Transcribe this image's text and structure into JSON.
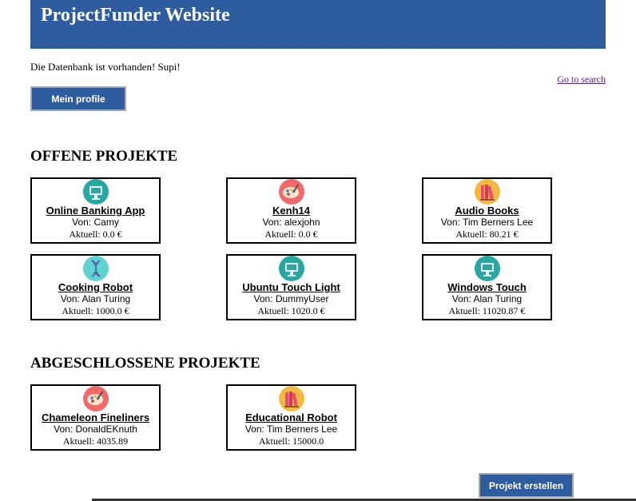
{
  "header": {
    "title": "ProjectFunder Website"
  },
  "db_status": "Die Datenbank ist vorhanden! Supi!",
  "search_link": "Go to search",
  "profile_button": "Mein profile",
  "create_button": "Projekt erstellen",
  "sections": {
    "open_title": "OFFENE PROJEKTE",
    "closed_title": "ABGESCHLOSSENE PROJEKTE"
  },
  "open_projects": [
    {
      "title": "Online Banking App",
      "author": "Von: Camy",
      "amount": "Aktuell: 0.0 €",
      "icon": "computer-icon"
    },
    {
      "title": "Kenh14",
      "author": "Von: alexjohn",
      "amount": "Aktuell: 0.0 €",
      "icon": "palette-icon"
    },
    {
      "title": "Audio Books",
      "author": "Von: Tim Berners Lee",
      "amount": "Aktuell: 80.21 €",
      "icon": "books-icon"
    },
    {
      "title": "Cooking Robot",
      "author": "Von: Alan Turing",
      "amount": "Aktuell: 1000.0 €",
      "icon": "dna-icon"
    },
    {
      "title": "Ubuntu Touch Light",
      "author": "Von: DummyUser",
      "amount": "Aktuell: 1020.0 €",
      "icon": "computer-icon"
    },
    {
      "title": "Windows Touch",
      "author": "Von: Alan Turing",
      "amount": "Aktuell: 11020.87 €",
      "icon": "computer-icon"
    }
  ],
  "closed_projects": [
    {
      "title": "Chameleon Fineliners ",
      "author": "Von: DonaldEKnuth",
      "amount": "Aktuell: 4035.89",
      "icon": "palette-icon"
    },
    {
      "title": "Educational Robot",
      "author": "Von: Tim Berners Lee",
      "amount": "Aktuell: 15000.0",
      "icon": "books-icon"
    }
  ],
  "colors": {
    "brand_blue": "#2e5c9e",
    "computer_icon_bg": "#2aa7a0",
    "palette_icon_bg": "#f06a6a",
    "books_icon_bg": "#f5b840",
    "dna_icon_bg": "#5fd3d0",
    "visited_link": "#551a8b"
  }
}
